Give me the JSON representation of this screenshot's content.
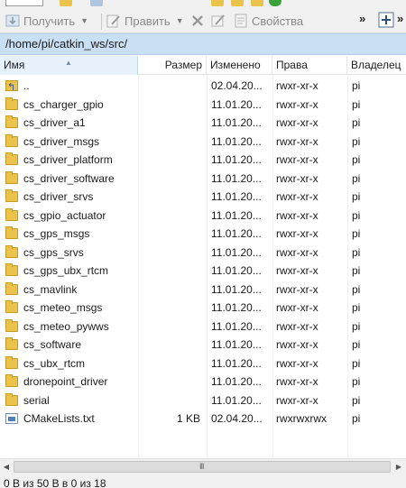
{
  "toolbar": {
    "get_label": "Получить",
    "edit_label": "Править",
    "props_label": "Свойства",
    "chevron": "»"
  },
  "path": "/home/pi/catkin_ws/src/",
  "columns": {
    "name": "Имя",
    "size": "Размер",
    "modified": "Изменено",
    "rights": "Права",
    "owner": "Владелец"
  },
  "files": [
    {
      "name": "..",
      "size": "",
      "modified": "02.04.20...",
      "rights": "rwxr-xr-x",
      "owner": "pi",
      "icon": "parent-folder-icon"
    },
    {
      "name": "cs_charger_gpio",
      "size": "",
      "modified": "11.01.20...",
      "rights": "rwxr-xr-x",
      "owner": "pi",
      "icon": "folder-icon"
    },
    {
      "name": "cs_driver_a1",
      "size": "",
      "modified": "11.01.20...",
      "rights": "rwxr-xr-x",
      "owner": "pi",
      "icon": "folder-icon"
    },
    {
      "name": "cs_driver_msgs",
      "size": "",
      "modified": "11.01.20...",
      "rights": "rwxr-xr-x",
      "owner": "pi",
      "icon": "folder-icon"
    },
    {
      "name": "cs_driver_platform",
      "size": "",
      "modified": "11.01.20...",
      "rights": "rwxr-xr-x",
      "owner": "pi",
      "icon": "folder-icon"
    },
    {
      "name": "cs_driver_software",
      "size": "",
      "modified": "11.01.20...",
      "rights": "rwxr-xr-x",
      "owner": "pi",
      "icon": "folder-icon"
    },
    {
      "name": "cs_driver_srvs",
      "size": "",
      "modified": "11.01.20...",
      "rights": "rwxr-xr-x",
      "owner": "pi",
      "icon": "folder-icon"
    },
    {
      "name": "cs_gpio_actuator",
      "size": "",
      "modified": "11.01.20...",
      "rights": "rwxr-xr-x",
      "owner": "pi",
      "icon": "folder-icon"
    },
    {
      "name": "cs_gps_msgs",
      "size": "",
      "modified": "11.01.20...",
      "rights": "rwxr-xr-x",
      "owner": "pi",
      "icon": "folder-icon"
    },
    {
      "name": "cs_gps_srvs",
      "size": "",
      "modified": "11.01.20...",
      "rights": "rwxr-xr-x",
      "owner": "pi",
      "icon": "folder-icon"
    },
    {
      "name": "cs_gps_ubx_rtcm",
      "size": "",
      "modified": "11.01.20...",
      "rights": "rwxr-xr-x",
      "owner": "pi",
      "icon": "folder-icon"
    },
    {
      "name": "cs_mavlink",
      "size": "",
      "modified": "11.01.20...",
      "rights": "rwxr-xr-x",
      "owner": "pi",
      "icon": "folder-icon"
    },
    {
      "name": "cs_meteo_msgs",
      "size": "",
      "modified": "11.01.20...",
      "rights": "rwxr-xr-x",
      "owner": "pi",
      "icon": "folder-icon"
    },
    {
      "name": "cs_meteo_pywws",
      "size": "",
      "modified": "11.01.20...",
      "rights": "rwxr-xr-x",
      "owner": "pi",
      "icon": "folder-icon"
    },
    {
      "name": "cs_software",
      "size": "",
      "modified": "11.01.20...",
      "rights": "rwxr-xr-x",
      "owner": "pi",
      "icon": "folder-icon"
    },
    {
      "name": "cs_ubx_rtcm",
      "size": "",
      "modified": "11.01.20...",
      "rights": "rwxr-xr-x",
      "owner": "pi",
      "icon": "folder-icon"
    },
    {
      "name": "dronepoint_driver",
      "size": "",
      "modified": "11.01.20...",
      "rights": "rwxr-xr-x",
      "owner": "pi",
      "icon": "folder-icon"
    },
    {
      "name": "serial",
      "size": "",
      "modified": "11.01.20...",
      "rights": "rwxr-xr-x",
      "owner": "pi",
      "icon": "folder-icon"
    },
    {
      "name": "CMakeLists.txt",
      "size": "1 KB",
      "modified": "02.04.20...",
      "rights": "rwxrwxrwx",
      "owner": "pi",
      "icon": "file-icon"
    }
  ],
  "scrollbar": {
    "grip": "III"
  },
  "status": "0 B из 50 B в 0 из 18"
}
